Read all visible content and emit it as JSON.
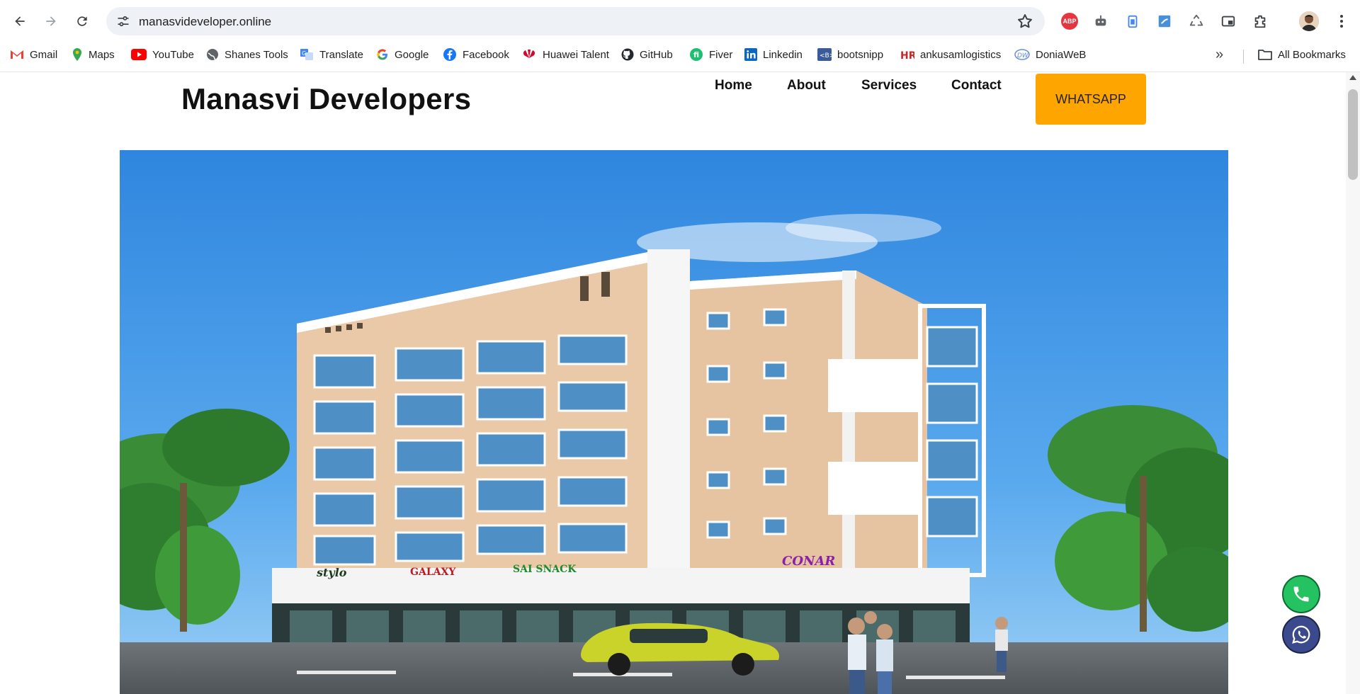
{
  "browser": {
    "url": "manasvideveloper.online",
    "bookmarks": [
      {
        "label": "Gmail",
        "icon": "gmail-icon",
        "color": "#ea4335"
      },
      {
        "label": "Maps",
        "icon": "maps-icon",
        "color": "#34a853"
      },
      {
        "label": "YouTube",
        "icon": "youtube-icon",
        "color": "#ff0000"
      },
      {
        "label": "Shanes Tools",
        "icon": "globe-icon",
        "color": "#5f6368"
      },
      {
        "label": "Translate",
        "icon": "translate-icon",
        "color": "#4285f4"
      },
      {
        "label": "Google",
        "icon": "google-icon",
        "color": "#4285f4"
      },
      {
        "label": "Facebook",
        "icon": "facebook-icon",
        "color": "#1877f2"
      },
      {
        "label": "Huawei Talent",
        "icon": "huawei-icon",
        "color": "#cf0a2c"
      },
      {
        "label": "GitHub",
        "icon": "github-icon",
        "color": "#24292f"
      },
      {
        "label": "Fiver",
        "icon": "fiverr-icon",
        "color": "#1dbf73"
      },
      {
        "label": "Linkedin",
        "icon": "linkedin-icon",
        "color": "#0a66c2"
      },
      {
        "label": "bootsnipp",
        "icon": "bootsnipp-icon",
        "color": "#3a5a99"
      },
      {
        "label": "ankusamlogistics",
        "icon": "hr-icon",
        "color": "#c62828"
      },
      {
        "label": "DoniaWeB",
        "icon": "doniaweb-icon",
        "color": "#6a8fd8"
      }
    ],
    "all_bookmarks": "All Bookmarks"
  },
  "site": {
    "brand": "Manasvi Developers",
    "nav": [
      "Home",
      "About",
      "Services",
      "Contact"
    ],
    "cta": "WHATSAPP",
    "storefront_signs": [
      "stylo",
      "GALAXY",
      "SAI SNACK",
      "CONAR"
    ]
  },
  "colors": {
    "cta": "#ffa500",
    "call_fab": "#25c262",
    "whatsapp_fab": "#3b4a8d"
  }
}
